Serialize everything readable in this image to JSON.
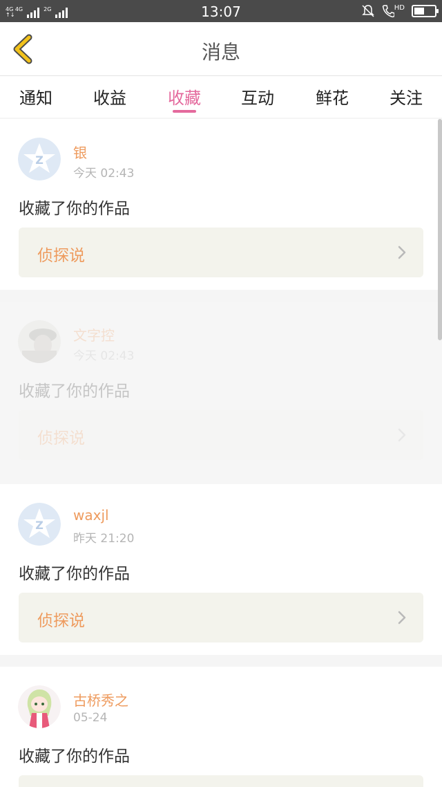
{
  "status_bar": {
    "time": "13:07",
    "network_1": "4G 4G",
    "network_2": "2G",
    "hd_label": "HD",
    "battery_level": 0.5,
    "icons": [
      "signal-icon",
      "mute-icon",
      "call-hd-icon",
      "battery-icon"
    ]
  },
  "header": {
    "title": "消息",
    "back_icon": "chevron-left-icon",
    "accent_color": "#f2c21b"
  },
  "tabs": [
    {
      "label": "通知"
    },
    {
      "label": "收益"
    },
    {
      "label": "收藏",
      "active": true
    },
    {
      "label": "互动"
    },
    {
      "label": "鲜花"
    },
    {
      "label": "关注"
    }
  ],
  "tab_accent_color": "#e46a9d",
  "messages": [
    {
      "name": "银",
      "time": "今天 02:43",
      "action": "收藏了你的作品",
      "work_title": "侦探说",
      "avatar": "default-star-avatar"
    },
    {
      "name": "文字控",
      "time": "今天 02:43",
      "action": "收藏了你的作品",
      "work_title": "侦探说",
      "avatar": "photo-avatar",
      "faded": true
    },
    {
      "name": "waxjl",
      "time": "昨天 21:20",
      "action": "收藏了你的作品",
      "work_title": "侦探说",
      "avatar": "default-star-avatar"
    },
    {
      "name": "古桥秀之",
      "time": "05-24",
      "action": "收藏了你的作品",
      "work_title": "",
      "avatar": "anime-avatar"
    }
  ]
}
